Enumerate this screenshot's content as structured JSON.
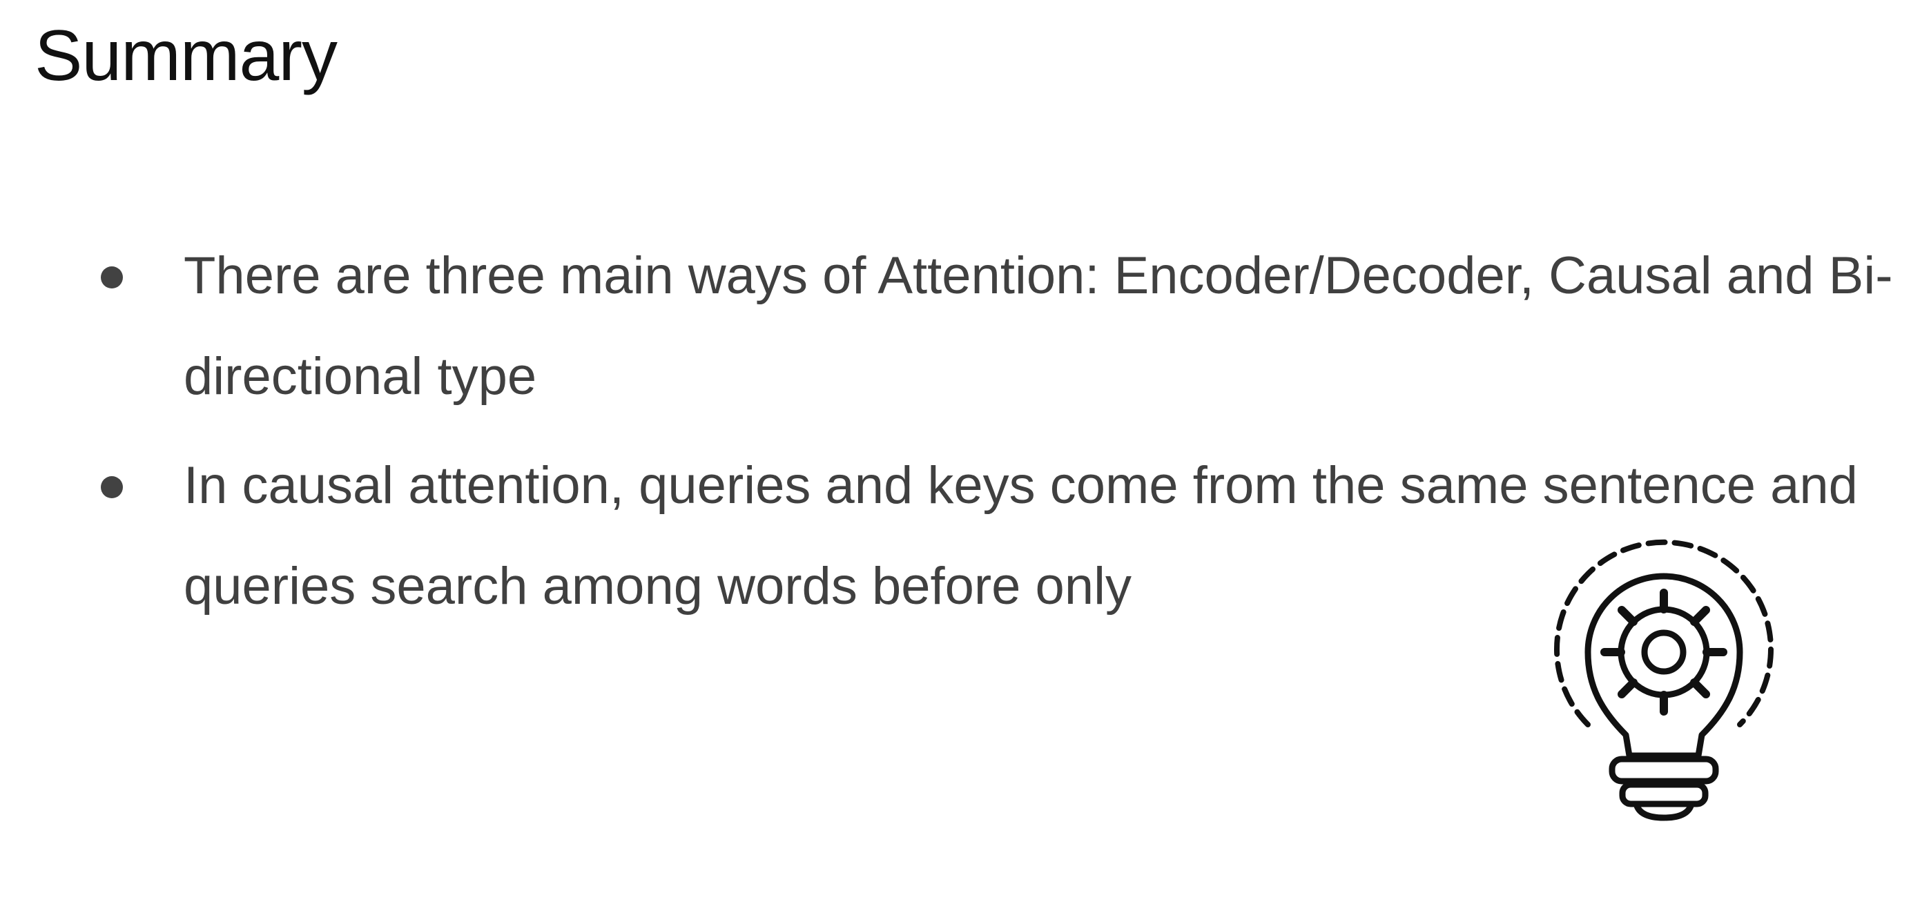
{
  "slide": {
    "title": "Summary",
    "bullets": [
      {
        "text": "There are three main ways of Attention: Encoder/Decoder, Causal and Bi-directional type"
      },
      {
        "text": "In causal attention, queries and keys come from the same sentence and queries search among words before only"
      }
    ],
    "icon": "lightbulb-gear-icon"
  }
}
